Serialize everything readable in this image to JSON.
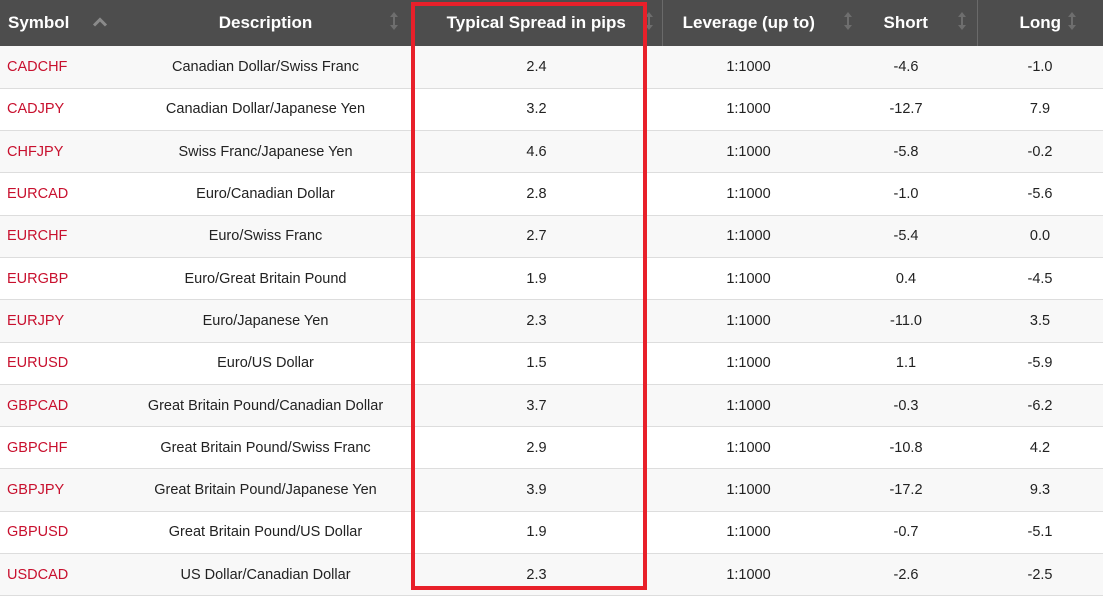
{
  "table": {
    "columns": [
      {
        "label": "Symbol",
        "sort": "ascending",
        "sort_icon": "chevron-up-icon"
      },
      {
        "label": "Description",
        "sort": "none",
        "sort_icon": "sort-updown-icon"
      },
      {
        "label": "Typical Spread in pips",
        "sort": "none",
        "sort_icon": "sort-updown-icon"
      },
      {
        "label": "Leverage (up to)",
        "sort": "none",
        "sort_icon": "sort-updown-icon"
      },
      {
        "label": "Short",
        "sort": "none",
        "sort_icon": "sort-updown-icon"
      },
      {
        "label": "Long",
        "sort": "none",
        "sort_icon": "sort-updown-icon"
      }
    ],
    "rows": [
      {
        "symbol": "CADCHF",
        "description": "Canadian Dollar/Swiss Franc",
        "spread": "2.4",
        "leverage": "1:1000",
        "short": "-4.6",
        "long": "-1.0"
      },
      {
        "symbol": "CADJPY",
        "description": "Canadian Dollar/Japanese Yen",
        "spread": "3.2",
        "leverage": "1:1000",
        "short": "-12.7",
        "long": "7.9"
      },
      {
        "symbol": "CHFJPY",
        "description": "Swiss Franc/Japanese Yen",
        "spread": "4.6",
        "leverage": "1:1000",
        "short": "-5.8",
        "long": "-0.2"
      },
      {
        "symbol": "EURCAD",
        "description": "Euro/Canadian Dollar",
        "spread": "2.8",
        "leverage": "1:1000",
        "short": "-1.0",
        "long": "-5.6"
      },
      {
        "symbol": "EURCHF",
        "description": "Euro/Swiss Franc",
        "spread": "2.7",
        "leverage": "1:1000",
        "short": "-5.4",
        "long": "0.0"
      },
      {
        "symbol": "EURGBP",
        "description": "Euro/Great Britain Pound",
        "spread": "1.9",
        "leverage": "1:1000",
        "short": "0.4",
        "long": "-4.5"
      },
      {
        "symbol": "EURJPY",
        "description": "Euro/Japanese Yen",
        "spread": "2.3",
        "leverage": "1:1000",
        "short": "-11.0",
        "long": "3.5"
      },
      {
        "symbol": "EURUSD",
        "description": "Euro/US Dollar",
        "spread": "1.5",
        "leverage": "1:1000",
        "short": "1.1",
        "long": "-5.9"
      },
      {
        "symbol": "GBPCAD",
        "description": "Great Britain Pound/Canadian Dollar",
        "spread": "3.7",
        "leverage": "1:1000",
        "short": "-0.3",
        "long": "-6.2"
      },
      {
        "symbol": "GBPCHF",
        "description": "Great Britain Pound/Swiss Franc",
        "spread": "2.9",
        "leverage": "1:1000",
        "short": "-10.8",
        "long": "4.2"
      },
      {
        "symbol": "GBPJPY",
        "description": "Great Britain Pound/Japanese Yen",
        "spread": "3.9",
        "leverage": "1:1000",
        "short": "-17.2",
        "long": "9.3"
      },
      {
        "symbol": "GBPUSD",
        "description": "Great Britain Pound/US Dollar",
        "spread": "1.9",
        "leverage": "1:1000",
        "short": "-0.7",
        "long": "-5.1"
      },
      {
        "symbol": "USDCAD",
        "description": "US Dollar/Canadian Dollar",
        "spread": "2.3",
        "leverage": "1:1000",
        "short": "-2.6",
        "long": "-2.5"
      }
    ]
  },
  "highlight": {
    "target_column": "Typical Spread in pips",
    "color": "#e8202a"
  },
  "colors": {
    "header_bg": "#4d4d4d",
    "symbol_text": "#c8102e",
    "row_alt": "#f8f8f8"
  }
}
